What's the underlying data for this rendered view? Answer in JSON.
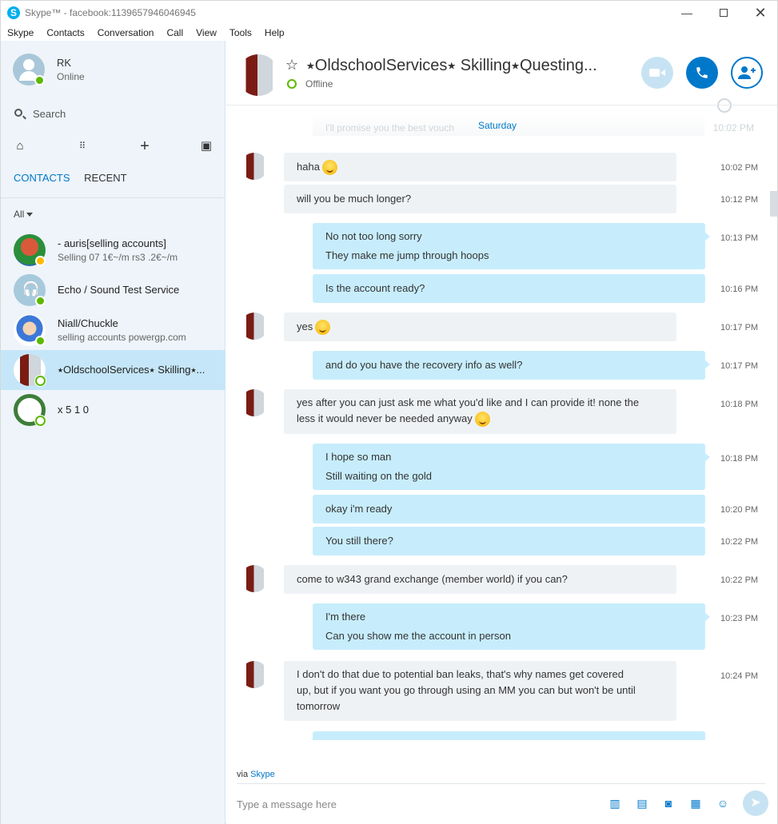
{
  "window": {
    "title": "Skype™ - facebook:1139657946046945"
  },
  "menu": [
    "Skype",
    "Contacts",
    "Conversation",
    "Call",
    "View",
    "Tools",
    "Help"
  ],
  "me": {
    "name": "RK",
    "status": "Online"
  },
  "search": {
    "label": "Search"
  },
  "tabs": {
    "contacts": "CONTACTS",
    "recent": "RECENT"
  },
  "filter": {
    "label": "All"
  },
  "contacts": [
    {
      "name": "-              auris[selling accounts]",
      "subtitle": "Selling 07 1€~/m rs3 .2€~/m",
      "status": "away"
    },
    {
      "name": "Echo / Sound Test Service",
      "subtitle": "",
      "status": "online"
    },
    {
      "name": "Niall/Chuckle",
      "subtitle": "selling accounts powergp.com",
      "status": "online"
    },
    {
      "name": "⭑OldschoolServices⭑ Skilling⭑...",
      "subtitle": "",
      "status": "offline"
    },
    {
      "name": "x 5 1 0",
      "subtitle": "",
      "status": "offline"
    }
  ],
  "chat": {
    "title": "⭑OldschoolServices⭑ Skilling⭑Questing...",
    "status": "Offline",
    "date_label": "Saturday",
    "ghost_text": "I'll promise you the best vouch",
    "ghost_time": "10:02 PM",
    "messages": [
      {
        "dir": "in",
        "lines": [
          "haha"
        ],
        "emoji": true,
        "time": "10:02 PM"
      },
      {
        "dir": "in",
        "lines": [
          "will you be much longer?"
        ],
        "time": "10:12 PM"
      },
      {
        "dir": "out",
        "lines": [
          "No not too long sorry",
          "They make me jump through hoops"
        ],
        "time": "10:13 PM"
      },
      {
        "dir": "out",
        "lines": [
          "Is the account ready?"
        ],
        "time": "10:16 PM"
      },
      {
        "dir": "in",
        "lines": [
          "yes"
        ],
        "emoji": true,
        "time": "10:17 PM"
      },
      {
        "dir": "out",
        "lines": [
          "and do you have the recovery info as well?"
        ],
        "time": "10:17 PM"
      },
      {
        "dir": "in",
        "lines": [
          "yes after you can just ask me what you'd like and I can provide it! none the",
          "less it would never be needed anyway"
        ],
        "emoji": true,
        "time": "10:18 PM"
      },
      {
        "dir": "out",
        "lines": [
          "I hope so man",
          "Still waiting on the gold"
        ],
        "time": "10:18 PM"
      },
      {
        "dir": "out",
        "lines": [
          "okay i'm ready"
        ],
        "time": "10:20 PM"
      },
      {
        "dir": "out",
        "lines": [
          "You still there?"
        ],
        "time": "10:22 PM"
      },
      {
        "dir": "in",
        "lines": [
          "come to w343 grand exchange (member world) if you can?"
        ],
        "time": "10:22 PM"
      },
      {
        "dir": "out",
        "lines": [
          "I'm there",
          "Can you show me the account in person"
        ],
        "time": "10:23 PM"
      },
      {
        "dir": "in",
        "lines": [
          "I don't do that due to potential ban leaks, that's why names get covered",
          "up, but if you want you go through using an MM you can but won't be until",
          "tomorrow"
        ],
        "time": "10:24 PM"
      }
    ]
  },
  "composer": {
    "via_prefix": "via",
    "via_link": "Skype",
    "placeholder": "Type a message here"
  },
  "colors": {
    "accent": "#0078ca",
    "outgoing_bubble": "#c7edfc",
    "incoming_bubble": "#eff2f5",
    "sidebar": "#eef4fa"
  },
  "icons": [
    "home-icon",
    "dialpad-icon",
    "plus-icon",
    "bot-icon",
    "video-icon",
    "phone-icon",
    "add-contact-icon",
    "globe-icon",
    "media-icon",
    "file-icon",
    "chat-bubble-icon",
    "contact-card-icon",
    "emoji-icon",
    "send-icon"
  ]
}
